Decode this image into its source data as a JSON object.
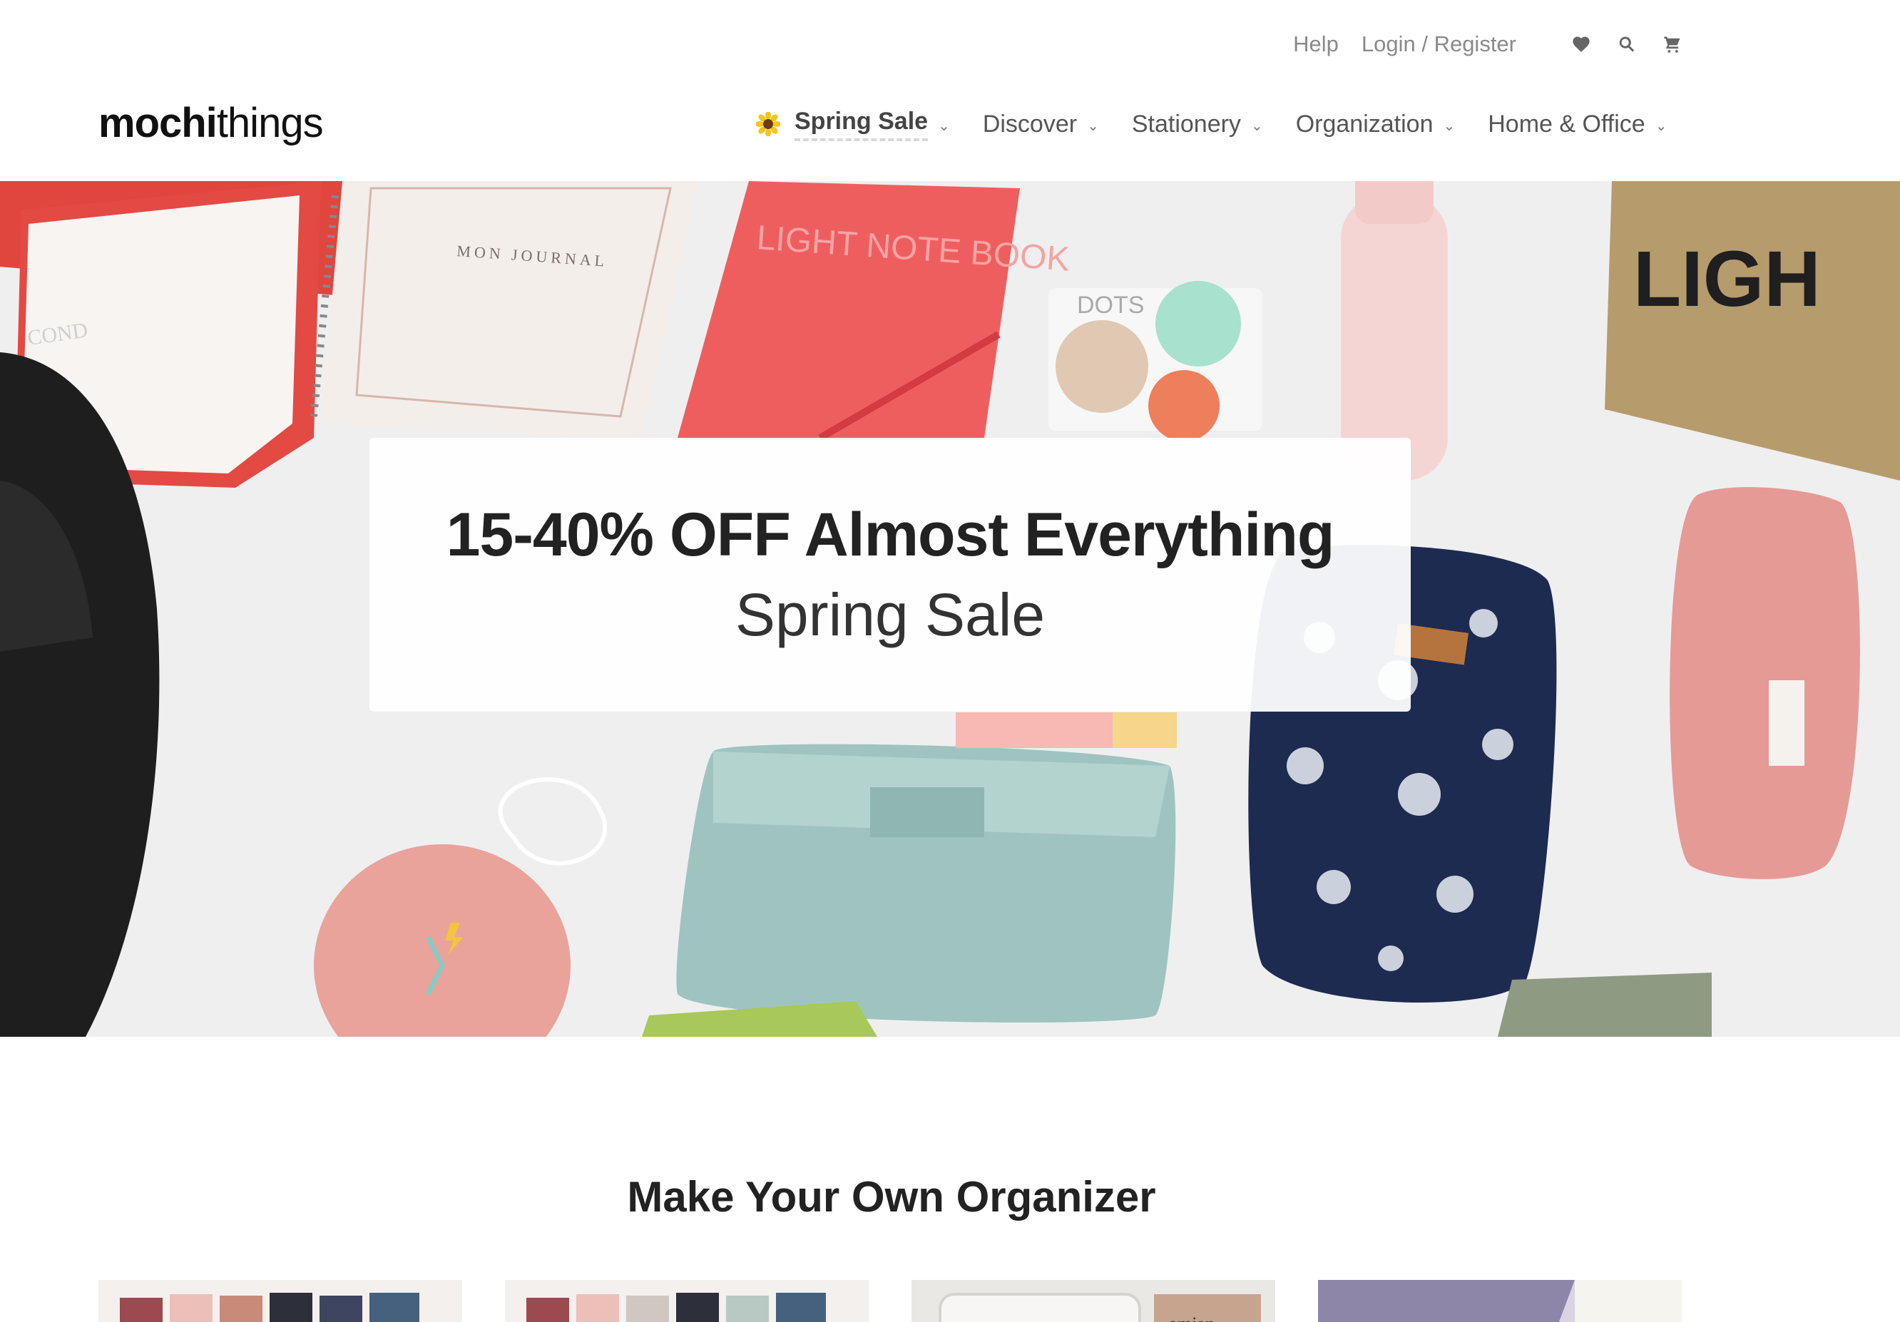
{
  "utility_nav": {
    "help": "Help",
    "login": "Login / Register",
    "icons": [
      "heart-icon",
      "search-icon",
      "cart-icon"
    ]
  },
  "header": {
    "logo_bold": "mochi",
    "logo_light": "things"
  },
  "main_nav": {
    "items": [
      {
        "label": "Spring Sale",
        "icon": "sunflower-icon"
      },
      {
        "label": "Discover"
      },
      {
        "label": "Stationery"
      },
      {
        "label": "Organization"
      },
      {
        "label": "Home & Office"
      }
    ]
  },
  "hero": {
    "title": "15-40% OFF Almost Everything",
    "subtitle": "Spring Sale",
    "image_text": {
      "journal": "MON JOURNAL",
      "notebook": "LIGHT NOTE BOOK",
      "stickers": "DOTS",
      "book": "LIGH"
    }
  },
  "section": {
    "title": "Make Your Own Organizer"
  },
  "colors": {
    "text_dark": "#222222",
    "text_nav": "#555555",
    "text_util": "#8a8a8a",
    "hero_bg": "#eeeeef"
  }
}
